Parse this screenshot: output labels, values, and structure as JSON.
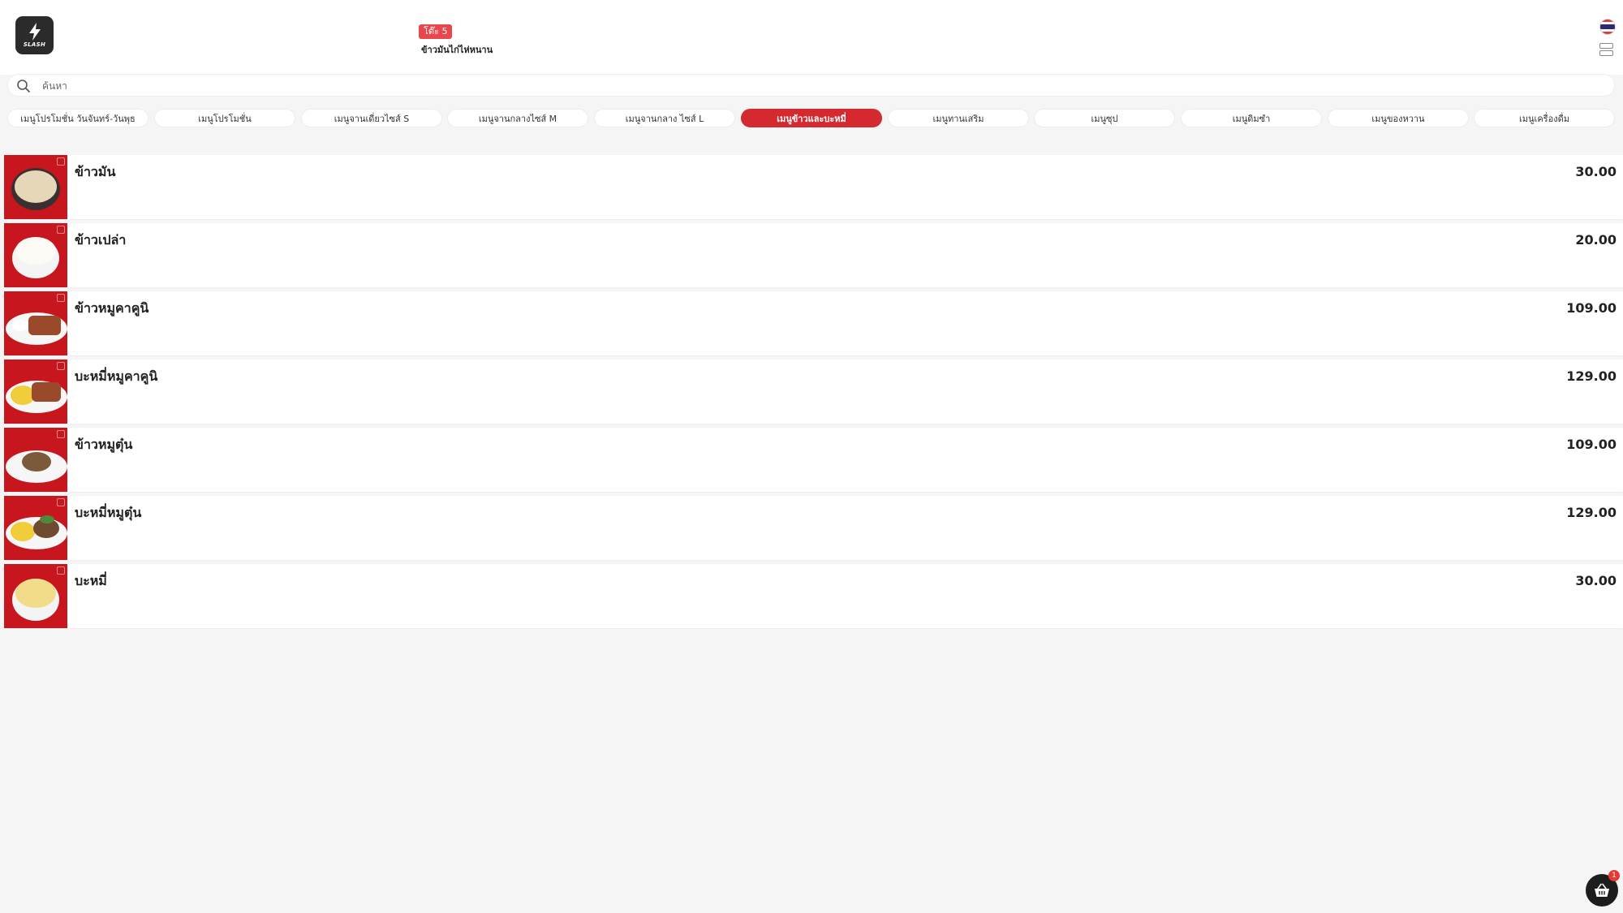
{
  "header": {
    "logo_text": "SLASH",
    "table_badge": "โต๊ะ 5",
    "store_name": "ข้าวมันไก่ไห่หนาน"
  },
  "search": {
    "placeholder": "ค้นหา"
  },
  "tabs": [
    {
      "label": "เมนูโปรโมชั่น วันจันทร์-วันพุธ",
      "active": false
    },
    {
      "label": "เมนูโปรโมชั่น",
      "active": false
    },
    {
      "label": "เมนูจานเดี่ยวไซส์ S",
      "active": false
    },
    {
      "label": "เมนูจานกลางไซส์ M",
      "active": false
    },
    {
      "label": "เมนูจานกลาง ไซส์ L",
      "active": false
    },
    {
      "label": "เมนูข้าวและบะหมี่",
      "active": true
    },
    {
      "label": "เมนูทานเสริม",
      "active": false
    },
    {
      "label": "เมนูซุป",
      "active": false
    },
    {
      "label": "เมนูดิมซำ",
      "active": false
    },
    {
      "label": "เมนูของหวาน",
      "active": false
    },
    {
      "label": "เมนูเครื่องดื่ม",
      "active": false
    }
  ],
  "menu_items": [
    {
      "name": "ข้าวมัน",
      "price": "30.00"
    },
    {
      "name": "ข้าวเปล่า",
      "price": "20.00"
    },
    {
      "name": "ข้าวหมูคาคูนิ",
      "price": "109.00"
    },
    {
      "name": "บะหมี่หมูคาคูนิ",
      "price": "129.00"
    },
    {
      "name": "ข้าวหมูตุ๋น",
      "price": "109.00"
    },
    {
      "name": "บะหมี่หมูตุ๋น",
      "price": "129.00"
    },
    {
      "name": "บะหมี่",
      "price": "30.00"
    }
  ],
  "cart": {
    "count": "1"
  },
  "colors": {
    "accent": "#d42a2f",
    "thumb_bg": "#c8161e",
    "dark": "#1d1d1d"
  },
  "icons": {
    "search": "search-icon",
    "cart": "basket-icon",
    "language": "thai-flag-icon",
    "view": "list-view-icon"
  }
}
